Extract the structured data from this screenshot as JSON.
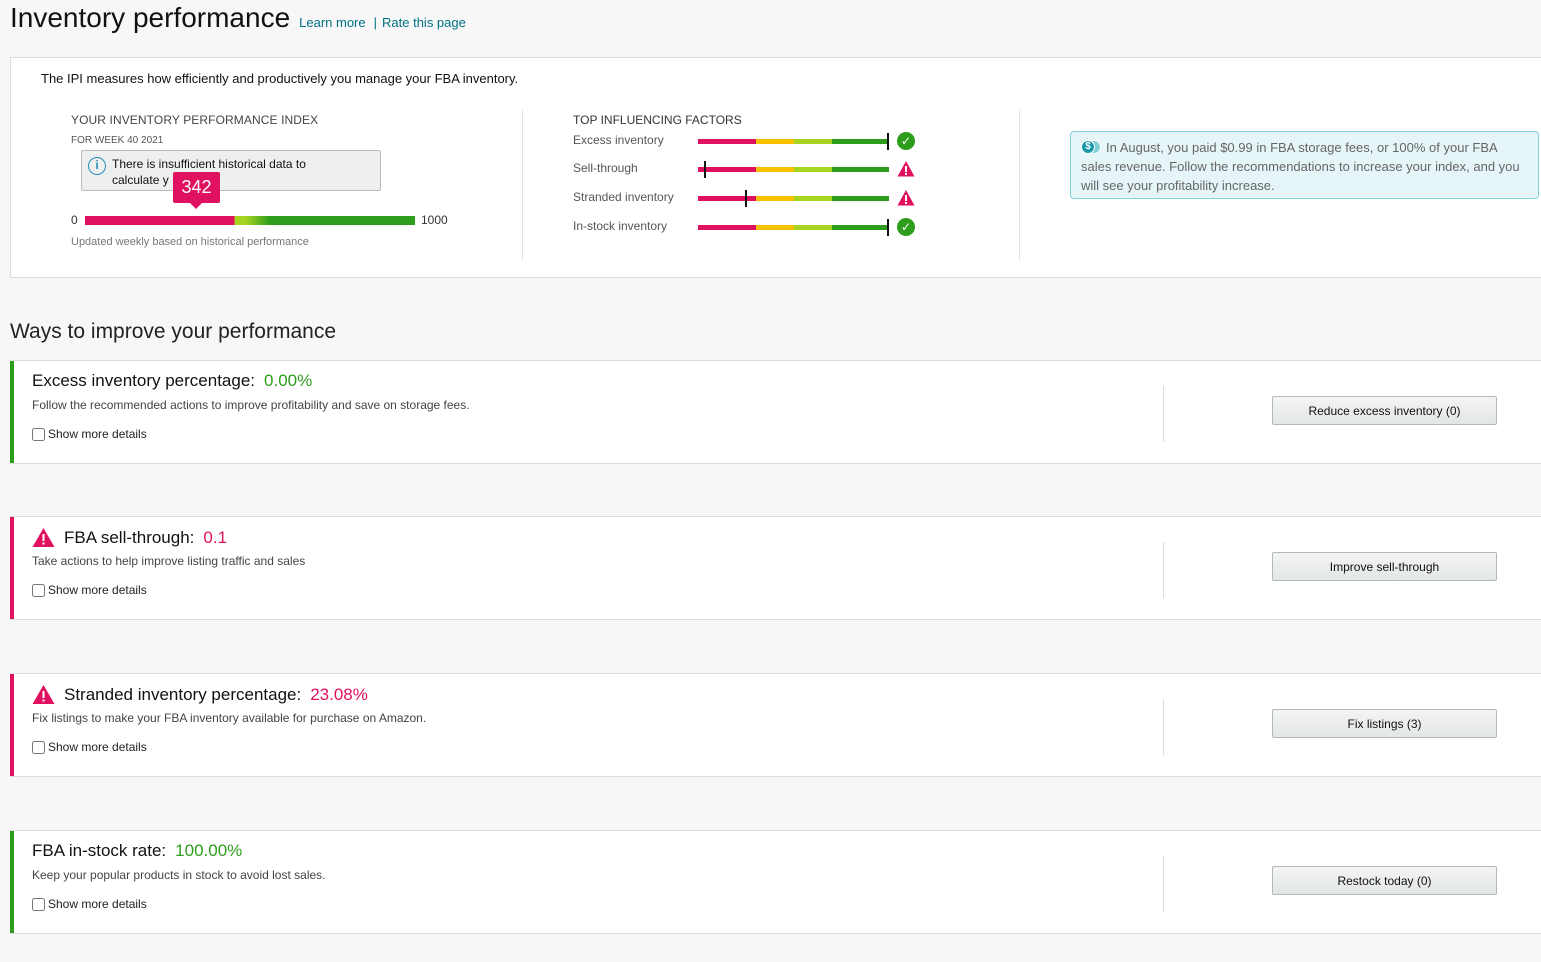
{
  "header": {
    "title": "Inventory performance",
    "learn_more": "Learn more",
    "separator": "|",
    "rate_page": "Rate this page"
  },
  "ipi": {
    "intro": "The IPI measures how efficiently and productively you manage your FBA inventory.",
    "title": "YOUR INVENTORY PERFORMANCE INDEX",
    "week": "FOR WEEK 40 2021",
    "tooltip": "There is insufficient historical data to calculate y",
    "score": "342",
    "min": "0",
    "max": "1000",
    "updated": "Updated weekly based on historical performance"
  },
  "factors": {
    "title": "TOP INFLUENCING FACTORS",
    "items": [
      {
        "label": "Excess inventory",
        "status": "check-icon",
        "level": 1.0
      },
      {
        "label": "Sell-through",
        "status": "warning-icon",
        "level": 0.03
      },
      {
        "label": "Stranded inventory",
        "status": "warning-icon",
        "level": 0.25
      },
      {
        "label": "In-stock inventory",
        "status": "check-icon",
        "level": 1.0
      }
    ]
  },
  "info_box": {
    "icon": "dollar-coins-icon",
    "text": "In August, you paid $0.99 in FBA storage fees, or 100% of your FBA sales revenue. Follow the recommendations to increase your index, and you will see your profitability increase."
  },
  "improve": {
    "title": "Ways to improve your performance",
    "cards": [
      {
        "title": "Excess inventory percentage:",
        "value": "0.00%",
        "status": "good",
        "description": "Follow the recommended actions to improve profitability and save on storage fees.",
        "details_label": "Show more details",
        "button": "Reduce excess inventory (0)"
      },
      {
        "title": "FBA sell-through:",
        "value": "0.1",
        "status": "warning",
        "description": "Take actions to help improve listing traffic and sales",
        "details_label": "Show more details",
        "button": "Improve sell-through"
      },
      {
        "title": "Stranded inventory percentage:",
        "value": "23.08%",
        "status": "warning",
        "description": "Fix listings to make your FBA inventory available for purchase on Amazon.",
        "details_label": "Show more details",
        "button": "Fix listings (3)"
      },
      {
        "title": "FBA in-stock rate:",
        "value": "100.00%",
        "status": "good",
        "description": "Keep your popular products in stock to avoid lost sales.",
        "details_label": "Show more details",
        "button": "Restock today (0)"
      }
    ]
  },
  "colors": {
    "good": "#2e9d1c",
    "warning": "#e0115f",
    "link": "#007185"
  }
}
